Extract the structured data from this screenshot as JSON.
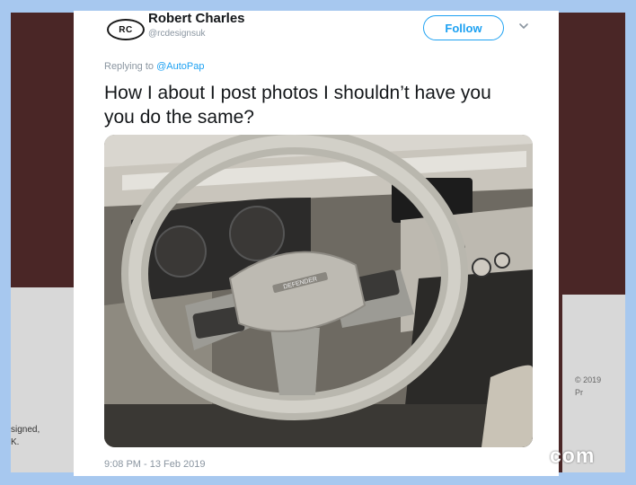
{
  "background": {
    "left_caption": "signed,\nK.",
    "right_caption": "© 2019\nPr"
  },
  "tweet": {
    "avatar_initials": "RC",
    "author_name": "Robert Charles",
    "author_handle": "@rcdesignsuk",
    "follow_label": "Follow",
    "replying_prefix": "Replying to ",
    "replying_to": "@AutoPap",
    "text": "How I about I post photos I shouldn’t have you you do the same?",
    "timestamp": "9:08 PM - 13 Feb 2019",
    "photo_badge": "DEFENDER"
  },
  "watermark": "com",
  "colors": {
    "accent": "#1da1f2",
    "frame": "#a7c8ef",
    "backdrop": "#4a2626"
  },
  "icons": {
    "menu": "chevron-down-icon"
  }
}
